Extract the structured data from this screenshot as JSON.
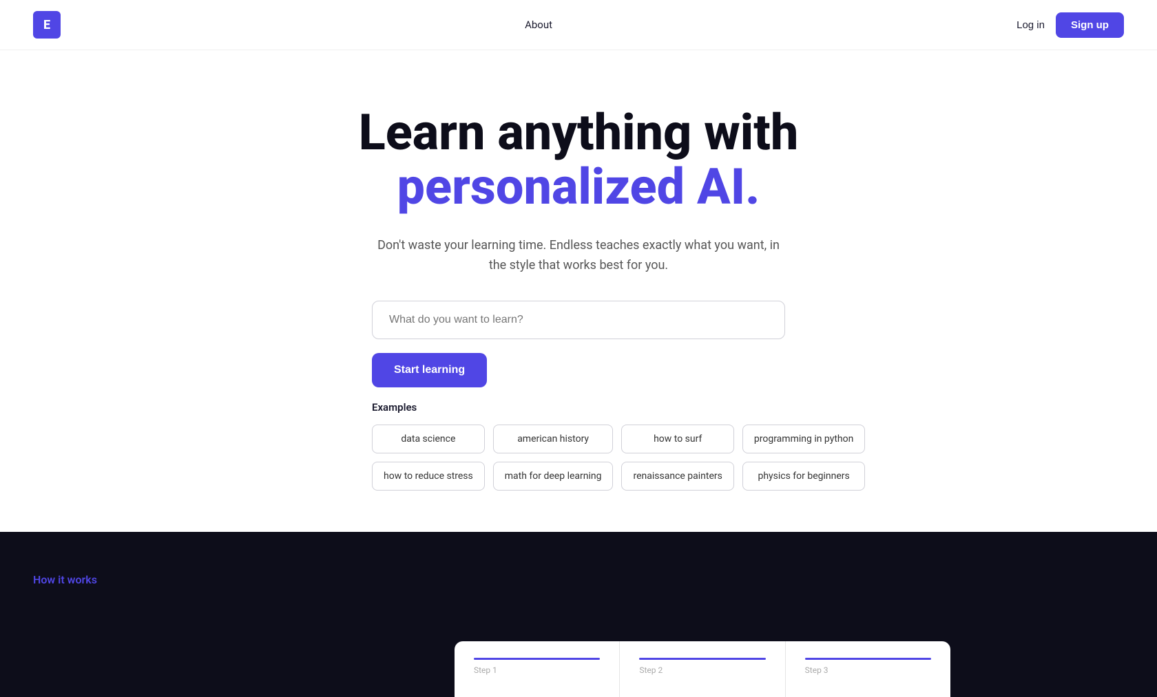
{
  "nav": {
    "logo_text": "E",
    "links": [
      {
        "label": "About"
      }
    ],
    "login_label": "Log in",
    "signup_label": "Sign up"
  },
  "hero": {
    "title_line1": "Learn anything with",
    "title_line2_accent": "personalized AI.",
    "subtitle": "Don't waste your learning time. Endless teaches exactly what you want, in the style that works best for you.",
    "search_placeholder": "What do you want to learn?",
    "cta_label": "Start learning",
    "examples_heading": "Examples",
    "examples_row1": [
      "data science",
      "american history",
      "how to surf",
      "programming in python"
    ],
    "examples_row2": [
      "how to reduce stress",
      "math for deep learning",
      "renaissance painters",
      "physics for beginners"
    ]
  },
  "dark_section": {
    "how_it_works": "How it works",
    "steps": [
      {
        "label": "Step 1"
      },
      {
        "label": "Step 2"
      },
      {
        "label": "Step 3"
      }
    ]
  }
}
